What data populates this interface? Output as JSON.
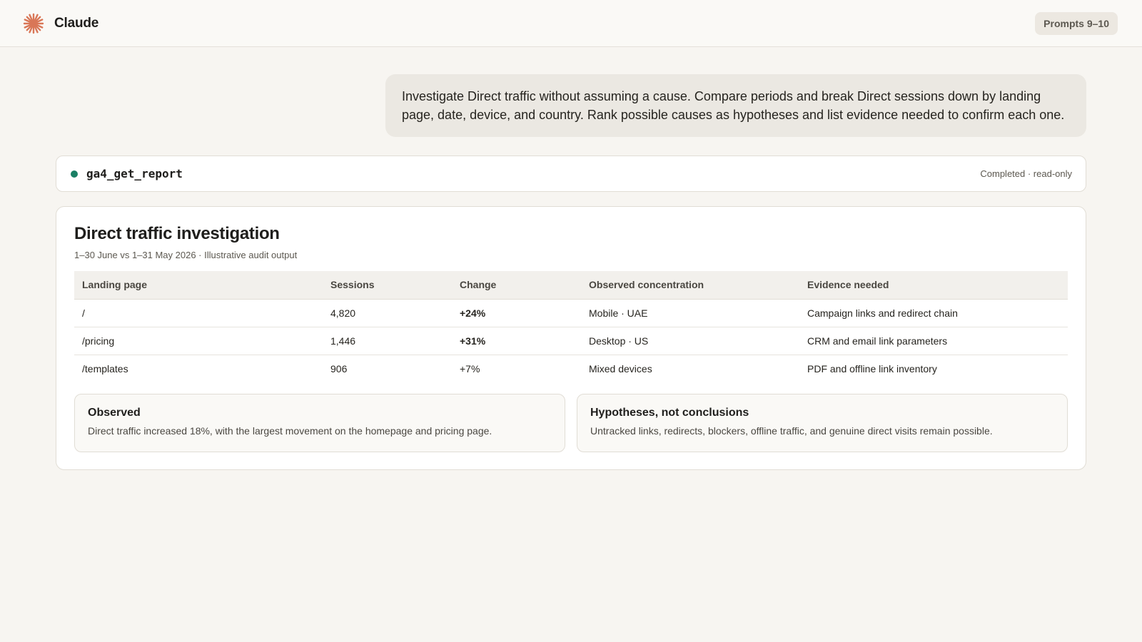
{
  "app": {
    "name": "Claude",
    "badge": "Prompts 9–10"
  },
  "colors": {
    "accent": "#d97757",
    "success": "#1a7f64",
    "change_highlight": "#a4501f"
  },
  "user_message": "Investigate Direct traffic without assuming a cause. Compare periods and break Direct sessions down by landing page, date, device, and country. Rank possible causes as hypotheses and list evidence needed to confirm each one.",
  "tool_call": {
    "name": "ga4_get_report",
    "status": "Completed · read-only",
    "status_icon": "status-dot"
  },
  "report": {
    "title": "Direct traffic investigation",
    "subtitle": "1–30 June vs 1–31 May 2026 · Illustrative audit output",
    "table": {
      "headers": [
        "Landing page",
        "Sessions",
        "Change",
        "Observed concentration",
        "Evidence needed"
      ],
      "rows": [
        [
          "/",
          "4,820",
          "+24%",
          "Mobile · UAE",
          "Campaign links and redirect chain"
        ],
        [
          "/pricing",
          "1,446",
          "+31%",
          "Desktop · US",
          "CRM and email link parameters"
        ],
        [
          "/templates",
          "906",
          "+7%",
          "Mixed devices",
          "PDF and offline link inventory"
        ]
      ]
    },
    "observed": {
      "title": "Observed",
      "body": "Direct traffic increased 18%, with the largest movement on the homepage and pricing page."
    },
    "hypotheses": {
      "title": "Hypotheses, not conclusions",
      "body": "Untracked links, redirects, blockers, offline traffic, and genuine direct visits remain possible."
    }
  }
}
